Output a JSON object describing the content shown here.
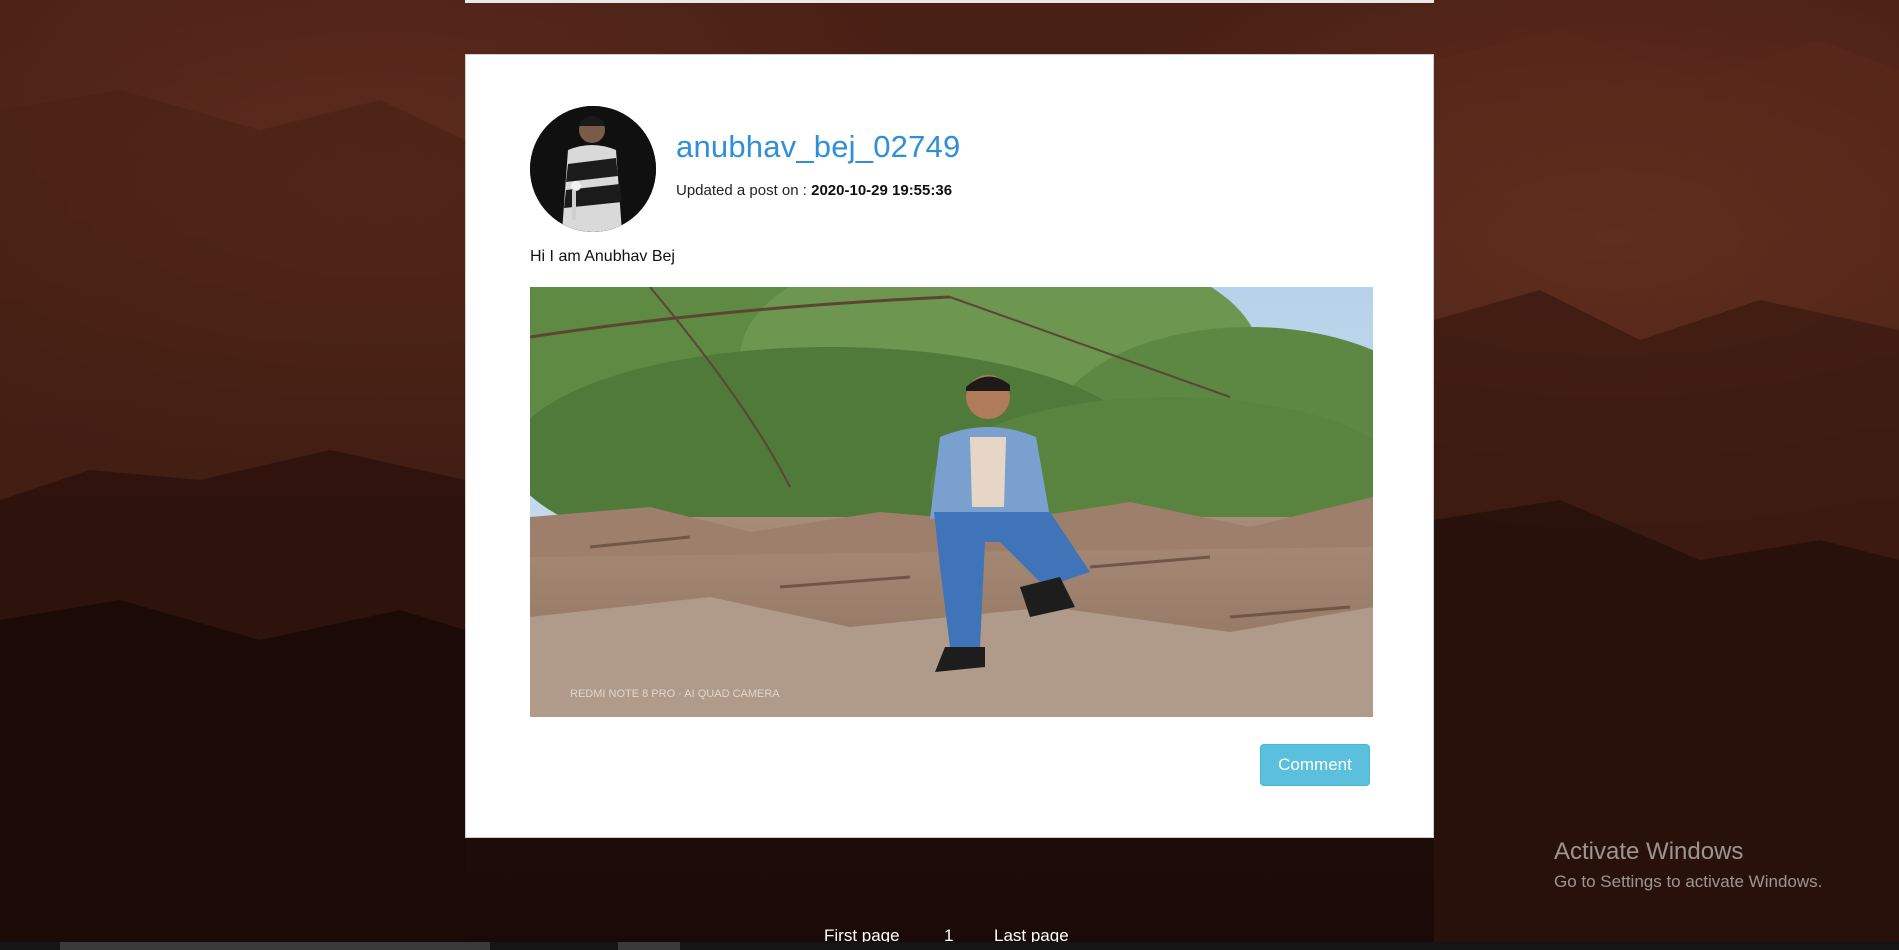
{
  "post": {
    "username": "anubhav_bej_02749",
    "updated_label": "Updated a post on : ",
    "updated_date": "2020-10-29 19:55:36",
    "text": "Hi I am Anubhav Bej",
    "comment_label": "Comment"
  },
  "pagination": {
    "first": "First page",
    "current": "1",
    "last": "Last page"
  },
  "watermark": {
    "title": "Activate Windows",
    "subtitle": "Go to Settings to activate Windows."
  },
  "colors": {
    "username": "#2f8fd8",
    "comment_button": "#5bc0de"
  }
}
